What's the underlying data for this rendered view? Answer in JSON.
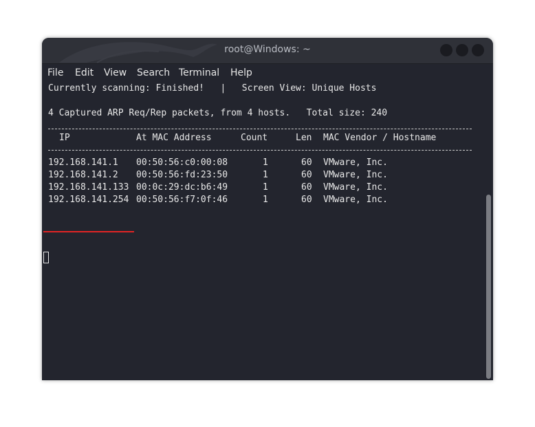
{
  "window": {
    "title": "root@Windows: ~"
  },
  "menu": {
    "items": [
      "File",
      "Edit",
      "View",
      "Search",
      "Terminal",
      "Help"
    ]
  },
  "terminal": {
    "status_line": "Currently scanning: Finished!   |   Screen View: Unique Hosts",
    "summary_line": "4 Captured ARP Req/Rep packets, from 4 hosts.   Total size: 240",
    "columns": [
      "IP",
      "At MAC Address",
      "Count",
      "Len",
      "MAC Vendor / Hostname"
    ],
    "rows": [
      {
        "ip": "192.168.141.1",
        "mac": "00:50:56:c0:00:08",
        "count": "1",
        "len": "60",
        "vendor": "VMware, Inc."
      },
      {
        "ip": "192.168.141.2",
        "mac": "00:50:56:fd:23:50",
        "count": "1",
        "len": "60",
        "vendor": "VMware, Inc."
      },
      {
        "ip": "192.168.141.133",
        "mac": "00:0c:29:dc:b6:49",
        "count": "1",
        "len": "60",
        "vendor": "VMware, Inc."
      },
      {
        "ip": "192.168.141.254",
        "mac": "00:50:56:f7:0f:46",
        "count": "1",
        "len": "60",
        "vendor": "VMware, Inc."
      }
    ],
    "highlighted_row": 2
  },
  "icons": {
    "window_logo": "kali-dragon-icon",
    "window_controls": [
      "minimize-icon",
      "maximize-icon",
      "close-icon"
    ]
  },
  "colors": {
    "terminal_bg": "#23252e",
    "titlebar_bg": "#2f3138",
    "text": "#e8e8e8",
    "highlight_underline": "#e32424"
  }
}
